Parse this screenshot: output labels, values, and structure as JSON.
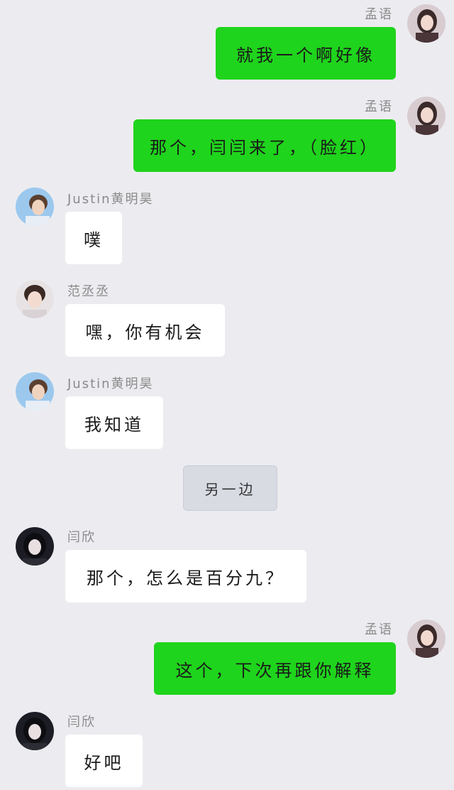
{
  "messages": [
    {
      "sender": "孟语",
      "text": "就我一个啊好像",
      "side": "right",
      "avatar": "girl-photo-avatar"
    },
    {
      "sender": "孟语",
      "text": "那个，闫闫来了，（脸红）",
      "side": "right",
      "avatar": "girl-photo-avatar"
    },
    {
      "sender": "Justin黄明昊",
      "text": "噗",
      "side": "left",
      "avatar": "boy-blue-avatar"
    },
    {
      "sender": "范丞丞",
      "text": "嘿，你有机会",
      "side": "left",
      "avatar": "boy-portrait-avatar"
    },
    {
      "sender": "Justin黄明昊",
      "text": "我知道",
      "side": "left",
      "avatar": "boy-blue-avatar"
    },
    {
      "sender": "闫欣",
      "text": "那个，怎么是百分九？",
      "side": "left",
      "avatar": "girl-dark-avatar"
    },
    {
      "sender": "孟语",
      "text": "这个，下次再跟你解释",
      "side": "right",
      "avatar": "girl-photo-avatar"
    },
    {
      "sender": "闫欣",
      "text": "好吧",
      "side": "left",
      "avatar": "girl-dark-avatar"
    }
  ],
  "system_message": "另一边",
  "colors": {
    "background": "#ececf0",
    "sent_bubble": "#1fd41c",
    "received_bubble": "#ffffff"
  }
}
